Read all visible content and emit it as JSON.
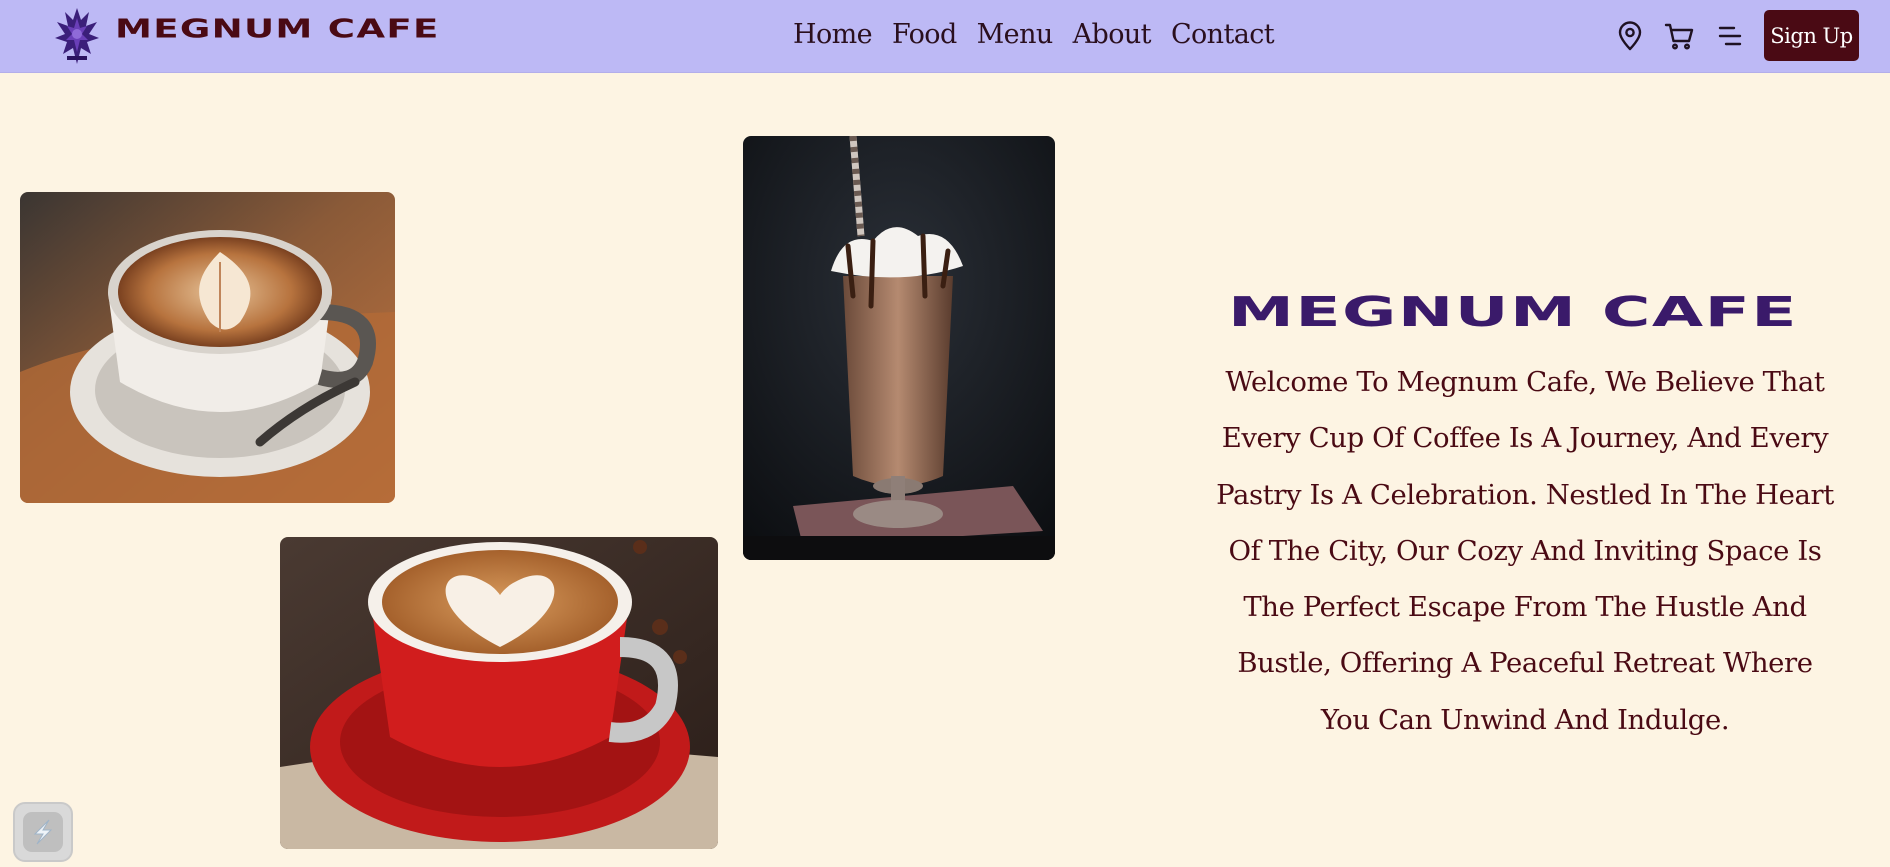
{
  "brand": {
    "name": "MEGNUM CAFE",
    "logo_icon": "phoenix-emblem-icon"
  },
  "nav": {
    "links": [
      "Home",
      "Food",
      "Menu",
      "About",
      "Contact"
    ],
    "icons": [
      "location-pin-icon",
      "cart-icon",
      "menu-icon"
    ],
    "signup_label": "Sign Up"
  },
  "hero": {
    "title": "MEGNUM CAFE",
    "description": "Welcome To Megnum Cafe, We Believe That Every Cup Of Coffee Is A Journey, And Every Pastry Is A Celebration. Nestled In The Heart Of The City, Our Cozy And Inviting Space Is The Perfect Escape From The Hustle And Bustle, Offering A Peaceful Retreat Where You Can Unwind And Indulge."
  },
  "gallery": [
    {
      "name": "latte-art-cup-photo"
    },
    {
      "name": "chocolate-milkshake-photo"
    },
    {
      "name": "heart-latte-red-cup-photo"
    }
  ],
  "colors": {
    "navbar_bg": "#bdb9f5",
    "page_bg": "#fdf4e3",
    "brand_maroon": "#4a0a14",
    "title_purple": "#3a1a6a"
  }
}
